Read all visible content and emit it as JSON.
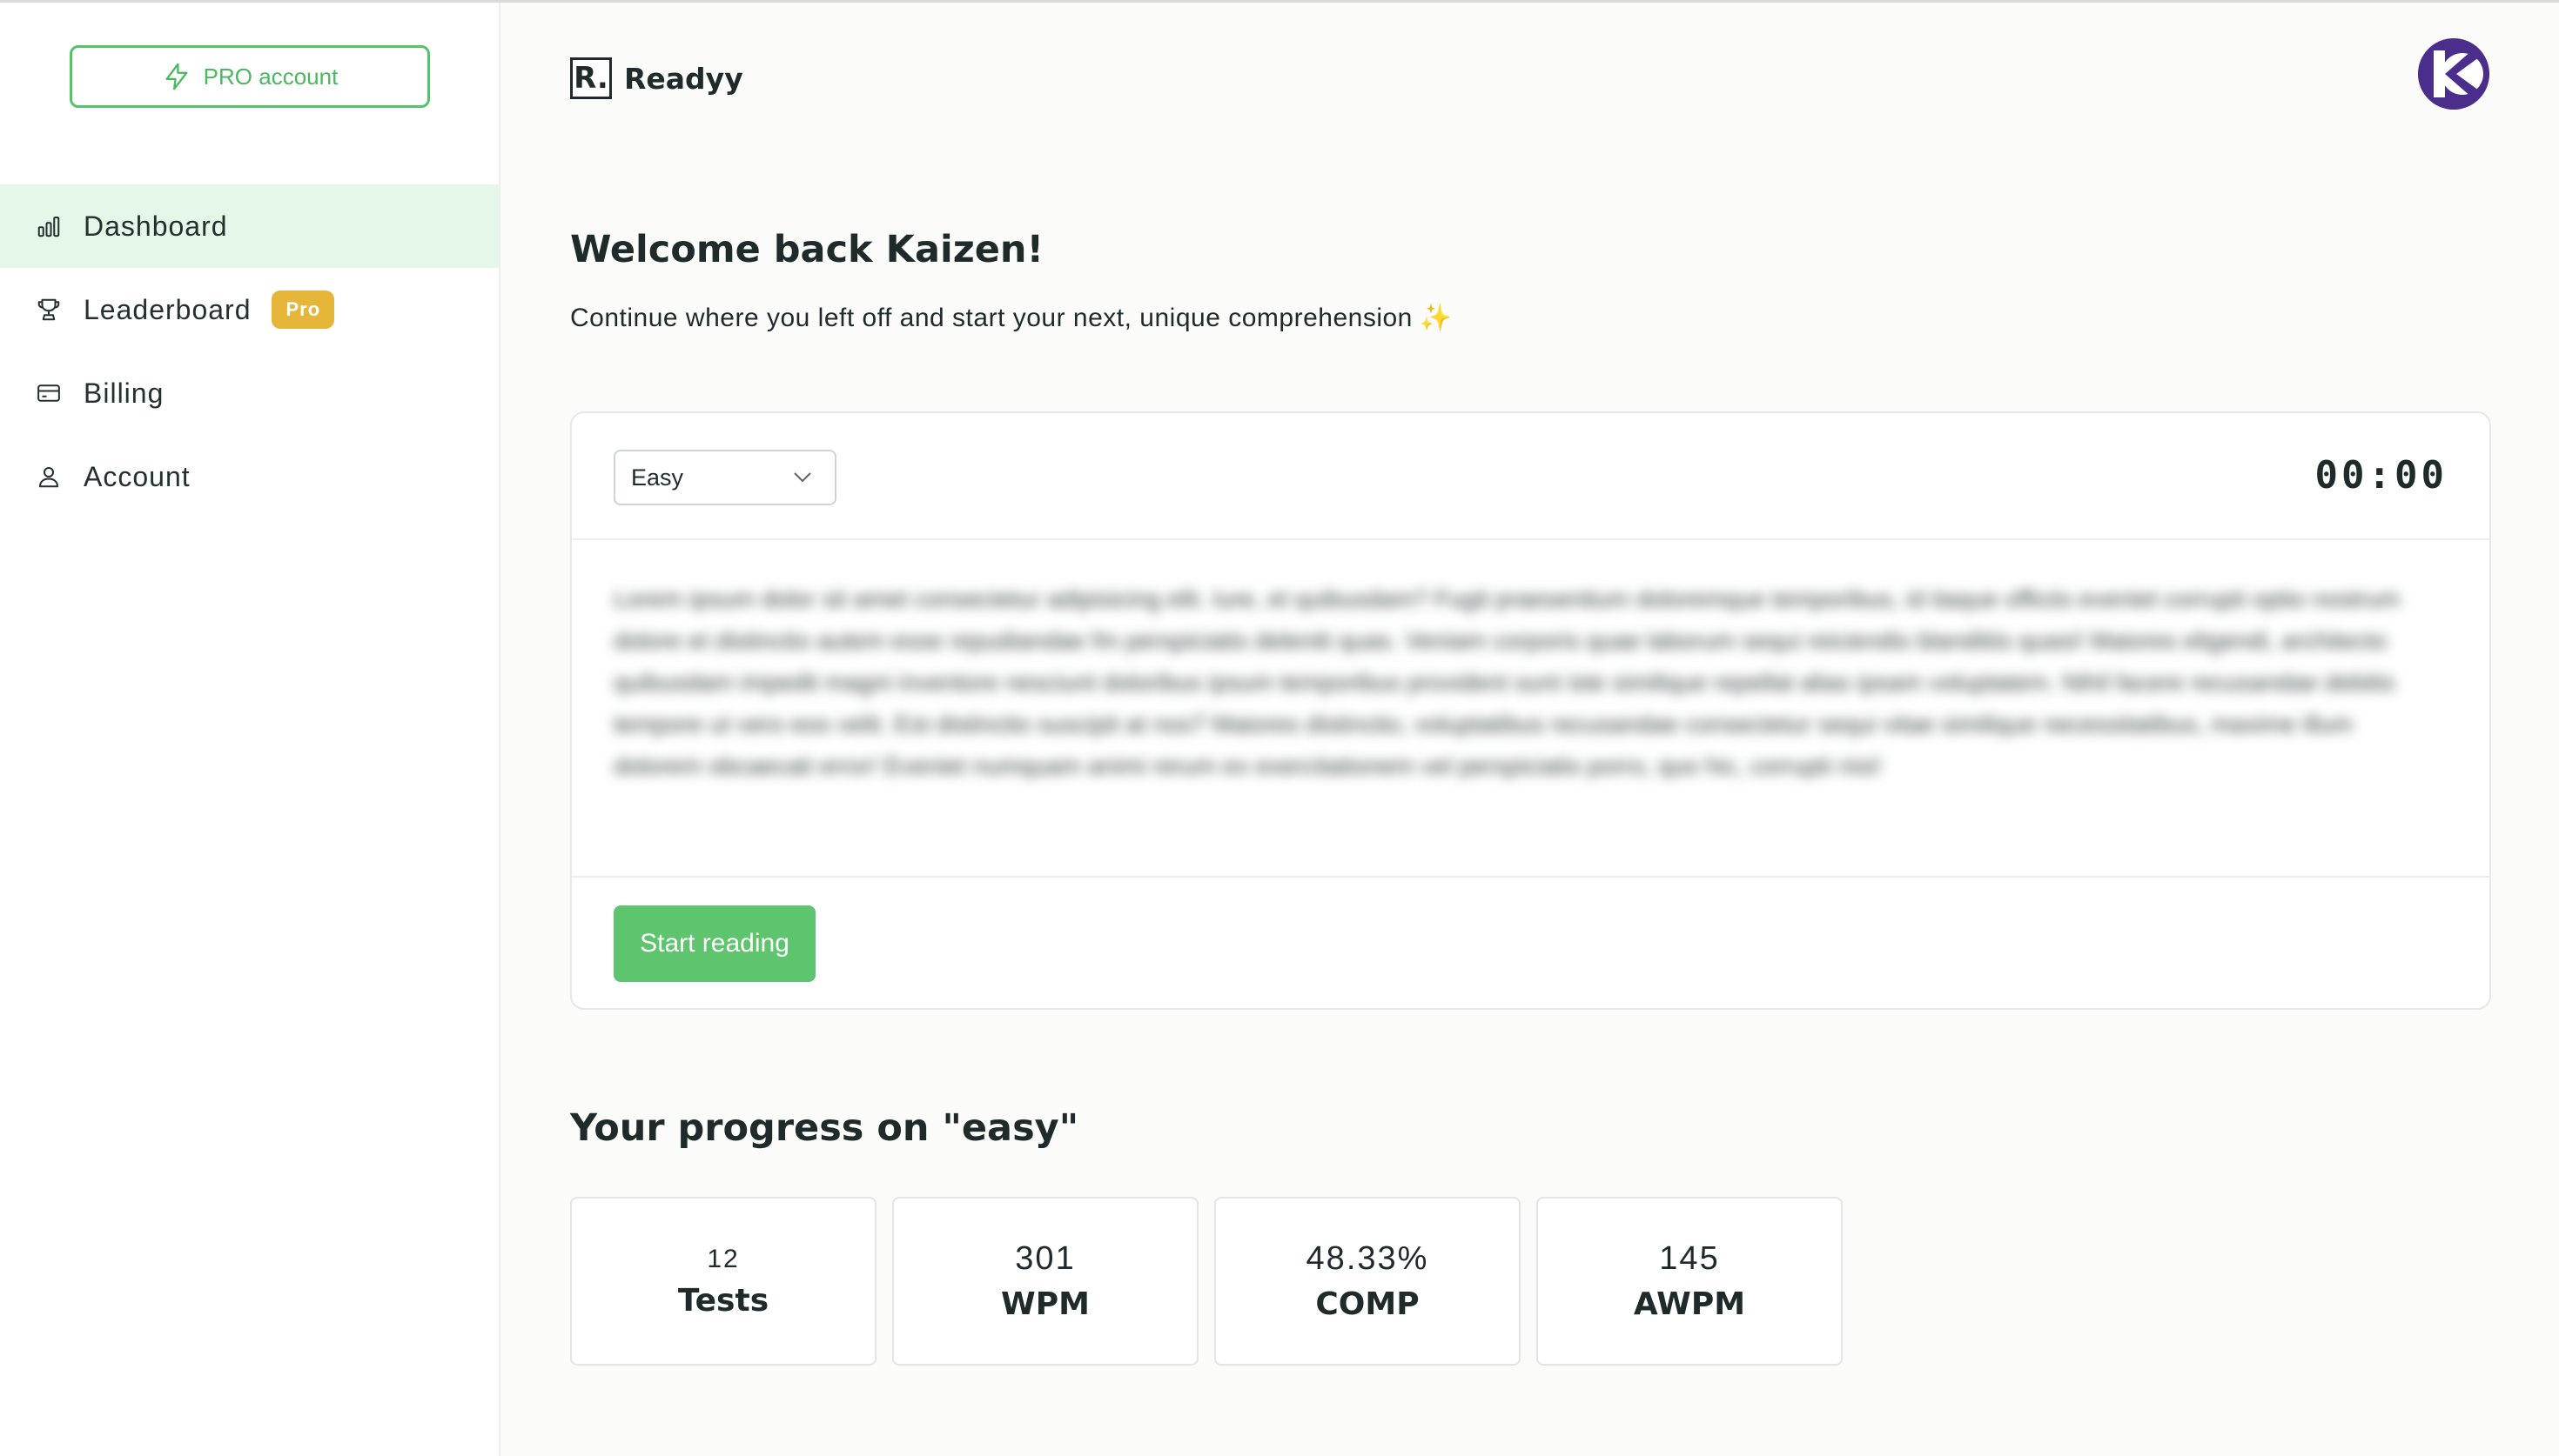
{
  "sidebar": {
    "pro_button": {
      "label": "PRO account",
      "icon": "lightning-icon"
    },
    "items": [
      {
        "label": "Dashboard",
        "icon": "bar-chart-icon",
        "active": true
      },
      {
        "label": "Leaderboard",
        "icon": "trophy-icon",
        "badge": "Pro"
      },
      {
        "label": "Billing",
        "icon": "credit-card-icon"
      },
      {
        "label": "Account",
        "icon": "user-icon"
      }
    ]
  },
  "header": {
    "logo_letter": "R.",
    "app_name": "Readyy",
    "avatar_letter": "K"
  },
  "main": {
    "welcome": "Welcome back Kaizen!",
    "subtitle": "Continue where you left off and start your next, unique comprehension",
    "sparkle": "✨",
    "card": {
      "difficulty": "Easy",
      "timer": "00:00",
      "reading_text": "Lorem ipsum dolor sit amet consectetur adipisicing elit. Iure, et quibusdam? Fugit praesentium doloremque temporibus, id itaque officiis eveniet corrupti optio nostrum dolore et distinctio autem esse repudiandae fm perspiciatis deleniti quas. Veniam corporis quae laborum sequi reiciendis blanditiis quasi! Maiores eligendi, architecto quibusdam impedit magni inventore nesciunt doloribus ipsum temporibus provident sunt iste similique repellat alias ipsam voluptatem. Nihil facere recusandae debitis tempore ut vero eos velit. Est distinctio suscipit at nos? Maiores distinctio, voluptatibus recusandae consectetur sequi vitae similique necessitatibus, maxime illum dolorem obcaecati error! Eveniet numquam animi rerum ex exercitationem vel perspiciatis porro, quo hic, corrupti nisi!",
      "start_button": "Start reading"
    },
    "progress_title": "Your progress on \"easy\"",
    "stats": [
      {
        "value": "12",
        "label": "Tests"
      },
      {
        "value": "301",
        "label": "WPM"
      },
      {
        "value": "48.33%",
        "label": "COMP"
      },
      {
        "value": "145",
        "label": "AWPM"
      }
    ]
  },
  "colors": {
    "accent_green": "#5ec46e",
    "active_nav_bg": "#e5f7e8",
    "pro_badge": "#e6b63a",
    "avatar_bg": "#4b2e8c"
  }
}
